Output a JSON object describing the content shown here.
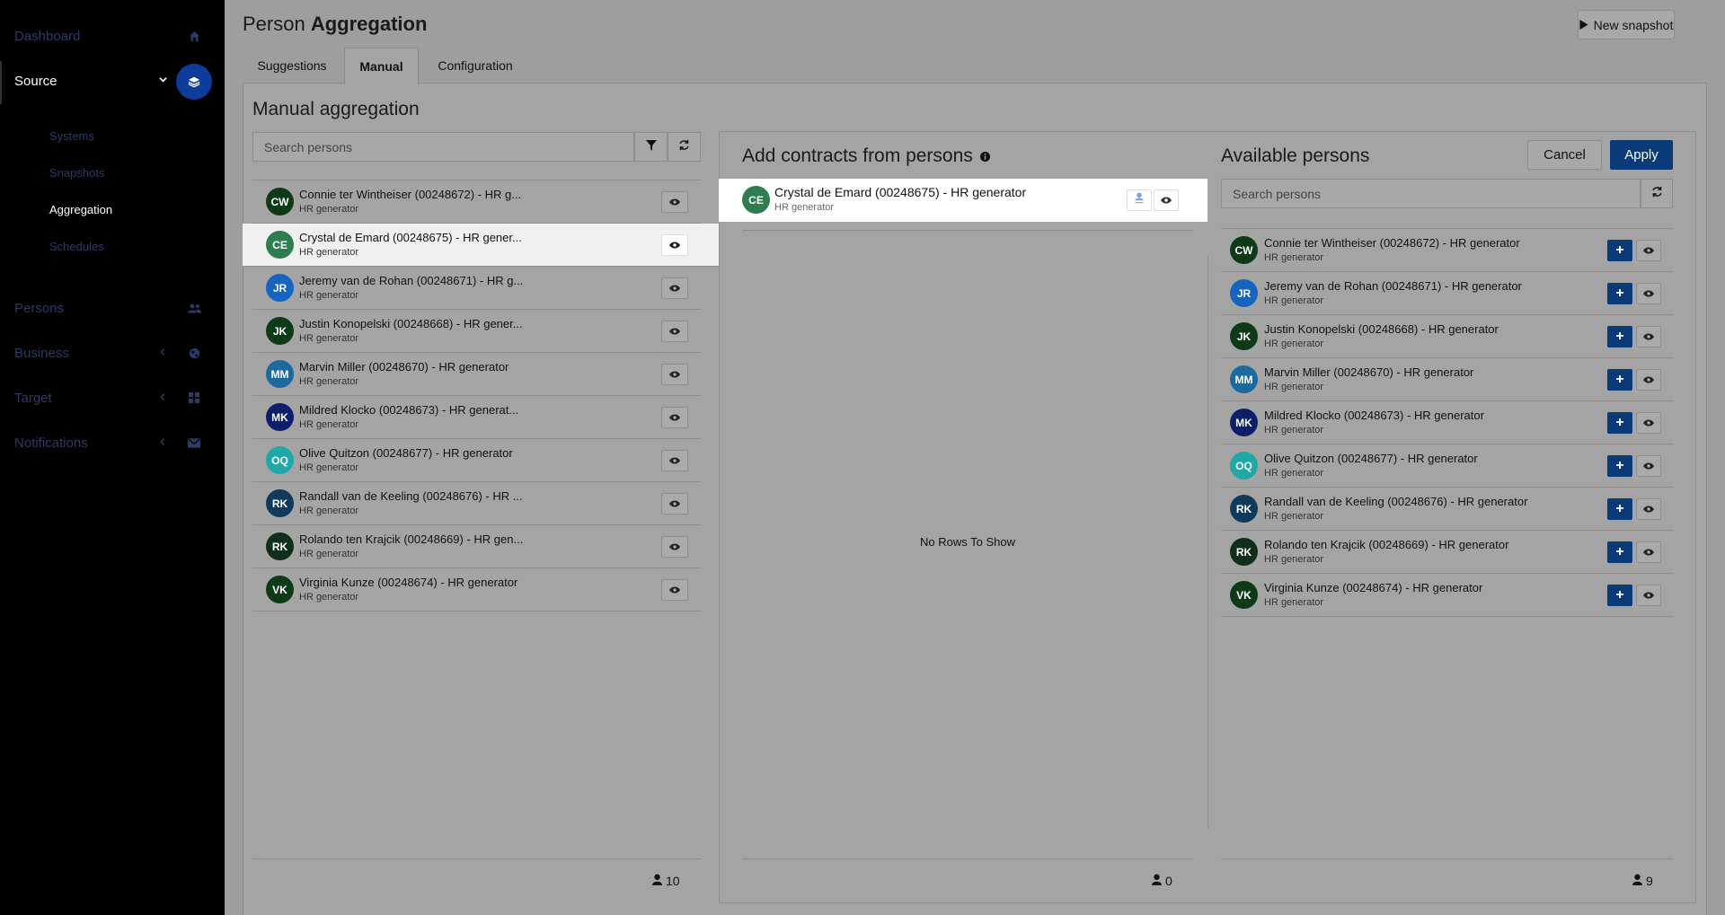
{
  "sidebar": {
    "items": [
      {
        "label": "Dashboard",
        "icon": "home-icon"
      },
      {
        "label": "Source",
        "icon": "layers-icon",
        "active": true
      },
      {
        "label": "Persons",
        "icon": "users-icon"
      },
      {
        "label": "Business",
        "icon": "globe-icon"
      },
      {
        "label": "Target",
        "icon": "grid-icon"
      },
      {
        "label": "Notifications",
        "icon": "envelope-icon"
      }
    ],
    "source_sub": [
      "Systems",
      "Snapshots",
      "Aggregation",
      "Schedules"
    ],
    "active_sub": "Aggregation"
  },
  "header": {
    "title_prefix": "Person",
    "title_bold": "Aggregation",
    "new_snapshot_label": "New snapshot"
  },
  "tabs": [
    "Suggestions",
    "Manual",
    "Configuration"
  ],
  "active_tab": "Manual",
  "manual": {
    "title": "Manual aggregation",
    "search_placeholder": "Search persons",
    "persons": [
      {
        "initials": "CW",
        "color": "#0f3a18",
        "name": "Connie ter Wintheiser (00248672) - HR g...",
        "sub": "HR generator"
      },
      {
        "initials": "CE",
        "color": "#2e7d4f",
        "name": "Crystal de Emard (00248675) - HR gener...",
        "sub": "HR generator",
        "highlighted": true
      },
      {
        "initials": "JR",
        "color": "#1565c0",
        "name": "Jeremy van de Rohan (00248671) - HR g...",
        "sub": "HR generator"
      },
      {
        "initials": "JK",
        "color": "#0f3a18",
        "name": "Justin Konopelski (00248668) - HR gener...",
        "sub": "HR generator"
      },
      {
        "initials": "MM",
        "color": "#1a6aa0",
        "name": "Marvin Miller (00248670) - HR generator",
        "sub": "HR generator"
      },
      {
        "initials": "MK",
        "color": "#0d1f6b",
        "name": "Mildred Klocko (00248673) - HR generat...",
        "sub": "HR generator"
      },
      {
        "initials": "OQ",
        "color": "#1fa8a8",
        "name": "Olive Quitzon (00248677) - HR generator",
        "sub": "HR generator"
      },
      {
        "initials": "RK",
        "color": "#0f3a5c",
        "name": "Randall van de Keeling (00248676) - HR ...",
        "sub": "HR generator"
      },
      {
        "initials": "RK",
        "color": "#0f2e1c",
        "name": "Rolando ten Krajcik (00248669) - HR gen...",
        "sub": "HR generator"
      },
      {
        "initials": "VK",
        "color": "#0f3a18",
        "name": "Virginia Kunze (00248674) - HR generator",
        "sub": "HR generator"
      }
    ],
    "count": "10"
  },
  "add_contracts": {
    "title": "Add contracts from persons",
    "selected": {
      "initials": "CE",
      "color": "#2e7d4f",
      "name": "Crystal de Emard (00248675) - HR generator",
      "sub": "HR generator"
    },
    "empty_text": "No Rows To Show",
    "count": "0"
  },
  "available": {
    "title": "Available persons",
    "cancel_label": "Cancel",
    "apply_label": "Apply",
    "search_placeholder": "Search persons",
    "persons": [
      {
        "initials": "CW",
        "color": "#0f3a18",
        "name": "Connie ter Wintheiser (00248672) - HR generator",
        "sub": "HR generator"
      },
      {
        "initials": "JR",
        "color": "#1565c0",
        "name": "Jeremy van de Rohan (00248671) - HR generator",
        "sub": "HR generator"
      },
      {
        "initials": "JK",
        "color": "#0f3a18",
        "name": "Justin Konopelski (00248668) - HR generator",
        "sub": "HR generator"
      },
      {
        "initials": "MM",
        "color": "#1a6aa0",
        "name": "Marvin Miller (00248670) - HR generator",
        "sub": "HR generator"
      },
      {
        "initials": "MK",
        "color": "#0d1f6b",
        "name": "Mildred Klocko (00248673) - HR generator",
        "sub": "HR generator"
      },
      {
        "initials": "OQ",
        "color": "#1fa8a8",
        "name": "Olive Quitzon (00248677) - HR generator",
        "sub": "HR generator"
      },
      {
        "initials": "RK",
        "color": "#0f3a5c",
        "name": "Randall van de Keeling (00248676) - HR generator",
        "sub": "HR generator"
      },
      {
        "initials": "RK",
        "color": "#0f2e1c",
        "name": "Rolando ten Krajcik (00248669) - HR generator",
        "sub": "HR generator"
      },
      {
        "initials": "VK",
        "color": "#0f3a18",
        "name": "Virginia Kunze (00248674) - HR generator",
        "sub": "HR generator"
      }
    ],
    "count": "9"
  }
}
